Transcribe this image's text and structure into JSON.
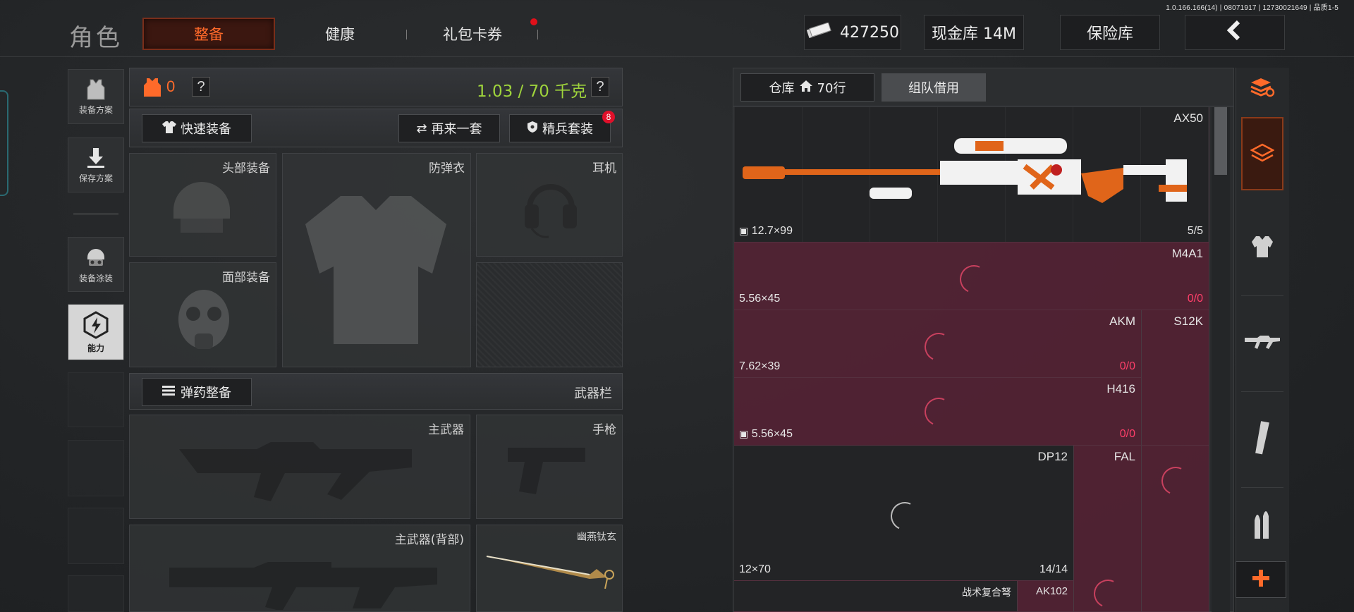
{
  "version": "1.0.166.166(14) | 08071917 | 12730021649 | 品质1-5",
  "header": {
    "title": "角色",
    "tabs": [
      {
        "label": "整备",
        "active": true
      },
      {
        "label": "健康",
        "active": false
      },
      {
        "label": "礼包卡券",
        "active": false,
        "has_dot": true
      }
    ],
    "money": "427250",
    "cash_vault": "现金库 14M",
    "safe_vault": "保险库"
  },
  "left_menu": {
    "items": [
      {
        "label": "装备方案",
        "icon": "vest-icon"
      },
      {
        "label": "保存方案",
        "icon": "download-icon"
      },
      {
        "label": "装备涂装",
        "icon": "helmet-paint-icon"
      },
      {
        "label": "能力",
        "icon": "ability-icon"
      }
    ]
  },
  "loadout": {
    "armor_count": "0",
    "help": "?",
    "weight": "1.03 / 70 千克",
    "quick_equip": "快速装备",
    "again": "再来一套",
    "elite_set": "精兵套装",
    "elite_badge": "8",
    "slots": {
      "head": "头部装备",
      "vest": "防弹衣",
      "headset": "耳机",
      "face": "面部装备"
    },
    "ammo_equip": "弹药整备",
    "weapon_bar": "武器栏",
    "weapons": {
      "primary": "主武器",
      "pistol": "手枪",
      "primary_back": "主武器(背部)",
      "melee": "幽燕钛玄"
    }
  },
  "warehouse": {
    "tab_label": "仓库",
    "tab_rows": "70行",
    "team_borrow": "组队借用",
    "items": [
      {
        "name": "AX50",
        "caliber": "12.7×99",
        "count": "5/5"
      },
      {
        "name": "M4A1",
        "caliber": "5.56×45",
        "count_a": "0",
        "count_b": "/0"
      },
      {
        "name": "AKM",
        "caliber": "7.62×39",
        "count_a": "0",
        "count_b": "/0"
      },
      {
        "name": "S12K"
      },
      {
        "name": "H416",
        "caliber": "5.56×45",
        "count_a": "0",
        "count_b": "/0"
      },
      {
        "name": "DP12",
        "caliber": "12×70",
        "count": "14/14"
      },
      {
        "name": "FAL"
      },
      {
        "name": "战术复合弩"
      },
      {
        "name": "AK102"
      }
    ]
  },
  "colors": {
    "accent": "#ff6a2a",
    "weight_green": "#9fd43c",
    "unavailable": "#6e1c36",
    "zero_red": "#ff3f6a"
  }
}
